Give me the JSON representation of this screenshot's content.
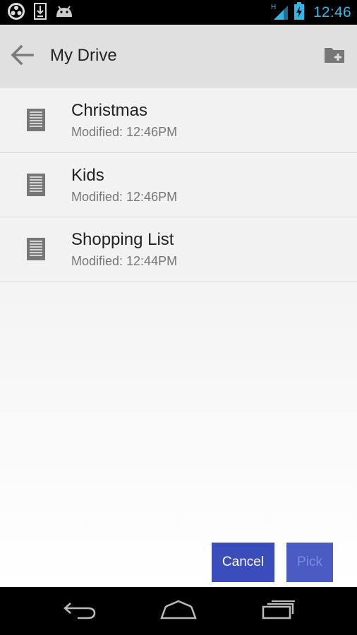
{
  "status_bar": {
    "time": "12:46",
    "network_label": "H",
    "icons": [
      "app-icon",
      "download-icon",
      "android-icon",
      "signal-icon",
      "battery-charging-icon"
    ],
    "clock_color": "#33b5e5"
  },
  "action_bar": {
    "title": "My Drive",
    "icons": [
      "back-arrow-icon",
      "new-folder-icon"
    ]
  },
  "files": [
    {
      "name": "Christmas",
      "modified": "Modified: 12:46PM",
      "icon": "document-icon"
    },
    {
      "name": "Kids",
      "modified": "Modified: 12:46PM",
      "icon": "document-icon"
    },
    {
      "name": "Shopping List",
      "modified": "Modified: 12:44PM",
      "icon": "document-icon"
    }
  ],
  "buttons": {
    "cancel_label": "Cancel",
    "pick_label": "Pick",
    "accent_color": "#3f51b5"
  },
  "nav_bar": {
    "icons": [
      "back-icon",
      "home-icon",
      "recent-apps-icon"
    ]
  }
}
